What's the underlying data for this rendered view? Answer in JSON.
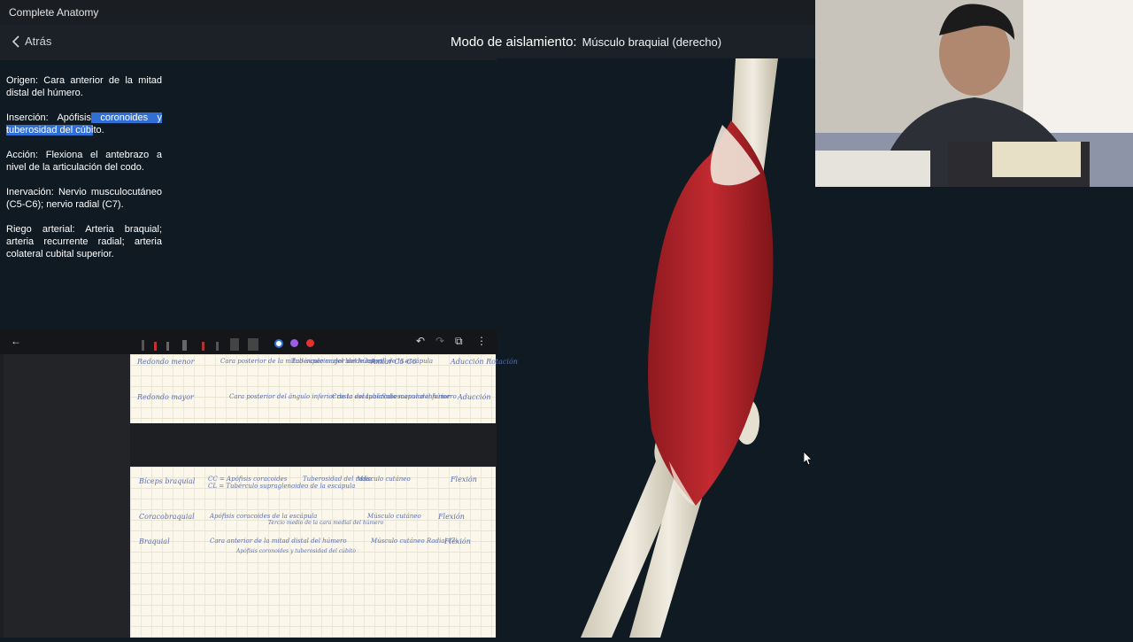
{
  "app": {
    "title": "Complete Anatomy"
  },
  "header": {
    "back_label": "Atrás",
    "mode_label": "Modo de aislamiento:",
    "muscle_name": "Músculo braquial (derecho)"
  },
  "info": {
    "origen": {
      "label": "Origen:",
      "text": "Cara anterior de la mitad distal del húmero."
    },
    "insercion": {
      "label": "Inserción:",
      "text_a": "Apófisis",
      "text_b": " coronoides y tuberosidad del cúbi",
      "text_c": "to."
    },
    "accion": {
      "label": "Acción:",
      "text": "Flexiona el antebrazo a nivel de la articulación del codo."
    },
    "inervacion": {
      "label": "Inervación:",
      "text": "Nervio musculocutáneo (C5-C6); nervio radial (C7)."
    },
    "riego": {
      "label": "Riego arterial:",
      "text": "Arteria braquial; arteria recurrente radial; arteria colateral cubital superior."
    }
  },
  "notes": {
    "pen_colors": [
      "#ffffff",
      "#9b5de5",
      "#e0332f"
    ],
    "page1": {
      "rows": [
        {
          "name": "Redondo menor",
          "origin": "Cara posterior de la mitad superior del borde lateral de la escápula",
          "insert": "Tubérculo mayor del húmero",
          "nerve": "Axilar C5-C6",
          "action": "Aducción Rotación"
        },
        {
          "name": "Redondo mayor",
          "origin": "Cara posterior del ángulo inferior de la escápula",
          "insert": "Cresta del tubérculo menor del húmero",
          "nerve": "Subescapular inferior",
          "action": "Aducción"
        }
      ]
    },
    "page2": {
      "rows": [
        {
          "name": "Bíceps braquial",
          "origin": "CC = Apófisis coracoides\nCL = Tubérculo supraglenoideo de la escápula",
          "insert": "Tuberosidad del radio",
          "nerve": "Músculo cutáneo",
          "action": "Flexión"
        },
        {
          "name": "Coracobraquial",
          "origin": "Apófisis coracoides de la escápula",
          "insert": "Tercio medio de la cara medial del húmero",
          "nerve": "Músculo cutáneo",
          "action": "Flexión"
        },
        {
          "name": "Braquial",
          "origin": "Cara anterior de la mitad distal del húmero",
          "insert": "Apófisis coronoides y tuberosidad del cúbito",
          "nerve": "Músculo cutáneo Radial (7)",
          "action": "Flexión"
        }
      ]
    }
  },
  "colors": {
    "accent_highlight": "#2f6fd6",
    "muscle": "#b8242a",
    "bone": "#e8e2d2"
  }
}
